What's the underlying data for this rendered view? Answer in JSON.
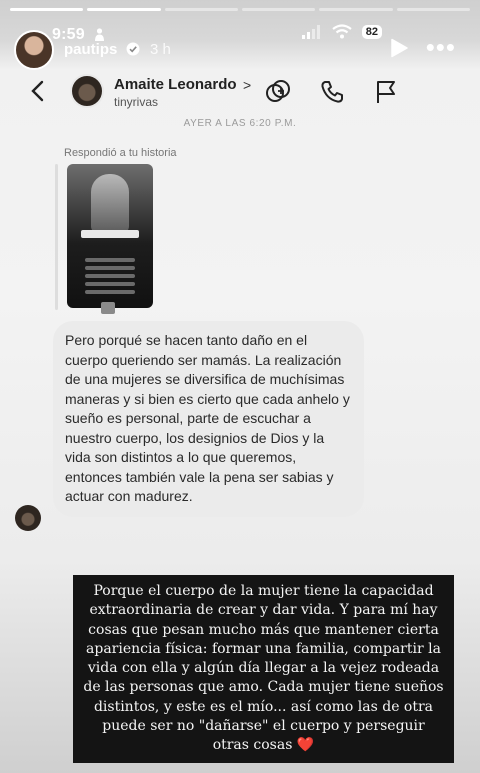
{
  "story": {
    "progress_total": 6,
    "progress_done": 2,
    "status_time": "9:59",
    "battery": "82",
    "username": "pautips",
    "time_ago": "3 h"
  },
  "dm": {
    "contact_name": "Amaite Leonardo",
    "contact_chevron": ">",
    "contact_handle": "tinyrivas",
    "timestamp": "AYER A LAS 6:20 P.M.",
    "replied_label": "Respondió a tu historia",
    "message": "Pero porqué se hacen tanto daño en el cuerpo queriendo ser mamás.  La realización de una mujeres se diversifica de muchísimas maneras y si bien es cierto que cada anhelo y sueño es personal, parte de escuchar a nuestro cuerpo, los designios de Dios y la vida son distintos a lo que queremos, entonces también vale la pena ser sabias y actuar con madurez."
  },
  "caption": {
    "text": "Porque el cuerpo de la mujer tiene la capacidad extraordinaria de crear y dar vida. Y para mí hay cosas que pesan mucho más que mantener cierta apariencia física: formar una familia, compartir la vida con ella y algún día llegar a la vejez rodeada de las personas que amo. Cada mujer tiene sueños distintos, y este es el mío... así como las de otra puede ser no \"dañarse\" el cuerpo y perseguir otras cosas",
    "heart": "❤️"
  },
  "colors": {
    "caption_bg": "#141414",
    "bubble_bg": "#ebebeb",
    "heart": "#e24a3b"
  },
  "icons": [
    "person-icon",
    "signal-icon",
    "wifi-icon",
    "battery-icon",
    "verified-icon",
    "play-icon",
    "more-icon",
    "back-icon",
    "video-call-icon",
    "phone-icon",
    "flag-icon"
  ]
}
